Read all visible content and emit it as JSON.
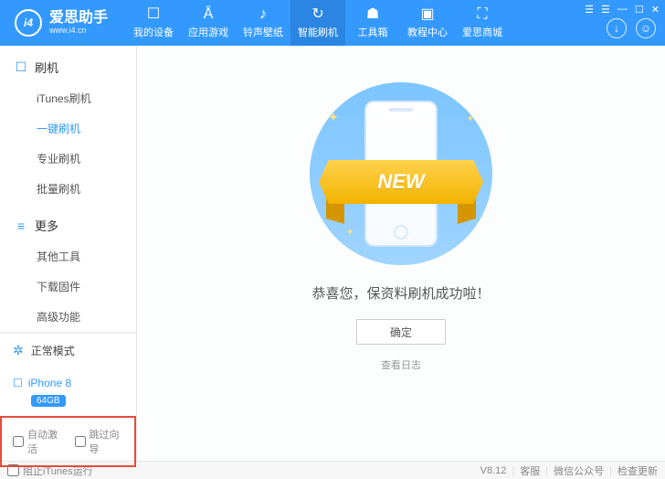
{
  "header": {
    "brand": "爱思助手",
    "url": "www.i4.cn",
    "logo_text": "i4",
    "nav": [
      {
        "icon": "☐",
        "label": "我的设备"
      },
      {
        "icon": "Å",
        "label": "应用游戏"
      },
      {
        "icon": "♪",
        "label": "铃声壁纸"
      },
      {
        "icon": "↻",
        "label": "智能刷机"
      },
      {
        "icon": "☗",
        "label": "工具箱"
      },
      {
        "icon": "▣",
        "label": "教程中心"
      },
      {
        "icon": "⛶",
        "label": "爱思商城"
      }
    ],
    "active_nav_index": 3,
    "win_controls": [
      "☰",
      "☰",
      "—",
      "☐",
      "✕"
    ],
    "side_icons": {
      "download": "↓",
      "user": "☺"
    }
  },
  "sidebar": {
    "sections": [
      {
        "icon": "☐",
        "title": "刷机",
        "items": [
          "iTunes刷机",
          "一键刷机",
          "专业刷机",
          "批量刷机"
        ],
        "active_index": 1
      },
      {
        "icon": "≡",
        "title": "更多",
        "items": [
          "其他工具",
          "下载固件",
          "高级功能"
        ],
        "active_index": -1
      }
    ],
    "mode": {
      "icon": "✲",
      "label": "正常模式"
    },
    "device": {
      "icon": "☐",
      "name": "iPhone 8",
      "storage": "64GB"
    },
    "options": {
      "auto_activate": "自动激活",
      "skip_wizard": "跳过向导"
    }
  },
  "content": {
    "ribbon": "NEW",
    "message": "恭喜您，保资料刷机成功啦！",
    "confirm_btn": "确定",
    "view_log": "查看日志"
  },
  "status_bar": {
    "block_itunes": "阻止iTunes运行",
    "version": "V8.12",
    "links": [
      "客服",
      "微信公众号",
      "检查更新"
    ]
  }
}
